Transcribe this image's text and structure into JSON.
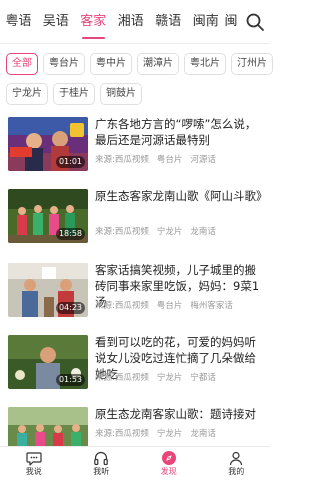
{
  "tabs": [
    "粤语",
    "吴语",
    "客家",
    "湘语",
    "赣语",
    "闽南",
    "闽"
  ],
  "active_tab": "客家",
  "chips_row1": [
    "全部",
    "粤台片",
    "粤中片",
    "潮漳片",
    "粤北片",
    "汀州片"
  ],
  "chips_row2": [
    "宁龙片",
    "于桂片",
    "铜鼓片"
  ],
  "active_chip": "全部",
  "feed": [
    {
      "title": "广东各地方言的“啰嗦”怎么说，最后还是河源话最特别",
      "duration": "01:01",
      "meta": [
        "来源:西瓜视频",
        "粤台片",
        "河源话"
      ]
    },
    {
      "title": "原生态客家龙南山歌《阿山斗歌》",
      "duration": "18:58",
      "meta": [
        "来源:西瓜视频",
        "宁龙片",
        "龙南话"
      ]
    },
    {
      "title": "客家话搞笑视频，儿子城里的搬砖同事来家里吃饭，妈妈：9菜1汤",
      "duration": "04:23",
      "meta": [
        "来源:西瓜视频",
        "粤台片",
        "梅州客家话"
      ]
    },
    {
      "title": "看到可以吃的花，可爱的妈妈听说女儿没吃过连忙摘了几朵做给她吃",
      "duration": "01:53",
      "meta": [
        "来源:西瓜视频",
        "宁龙片",
        "宁都话"
      ]
    },
    {
      "title": "原生态龙南客家山歌：题诗接对",
      "duration": "",
      "meta": [
        "来源:西瓜视频",
        "宁龙片",
        "龙南话"
      ]
    }
  ],
  "nav": [
    {
      "label": "我说",
      "icon": "chat-icon"
    },
    {
      "label": "我听",
      "icon": "headphones-icon"
    },
    {
      "label": "发现",
      "icon": "discover-compass-icon"
    },
    {
      "label": "我的",
      "icon": "person-icon"
    }
  ],
  "active_nav": "发现",
  "colors": {
    "accent": "#e8457a",
    "text": "#222222",
    "muted": "#9a9a9a"
  }
}
